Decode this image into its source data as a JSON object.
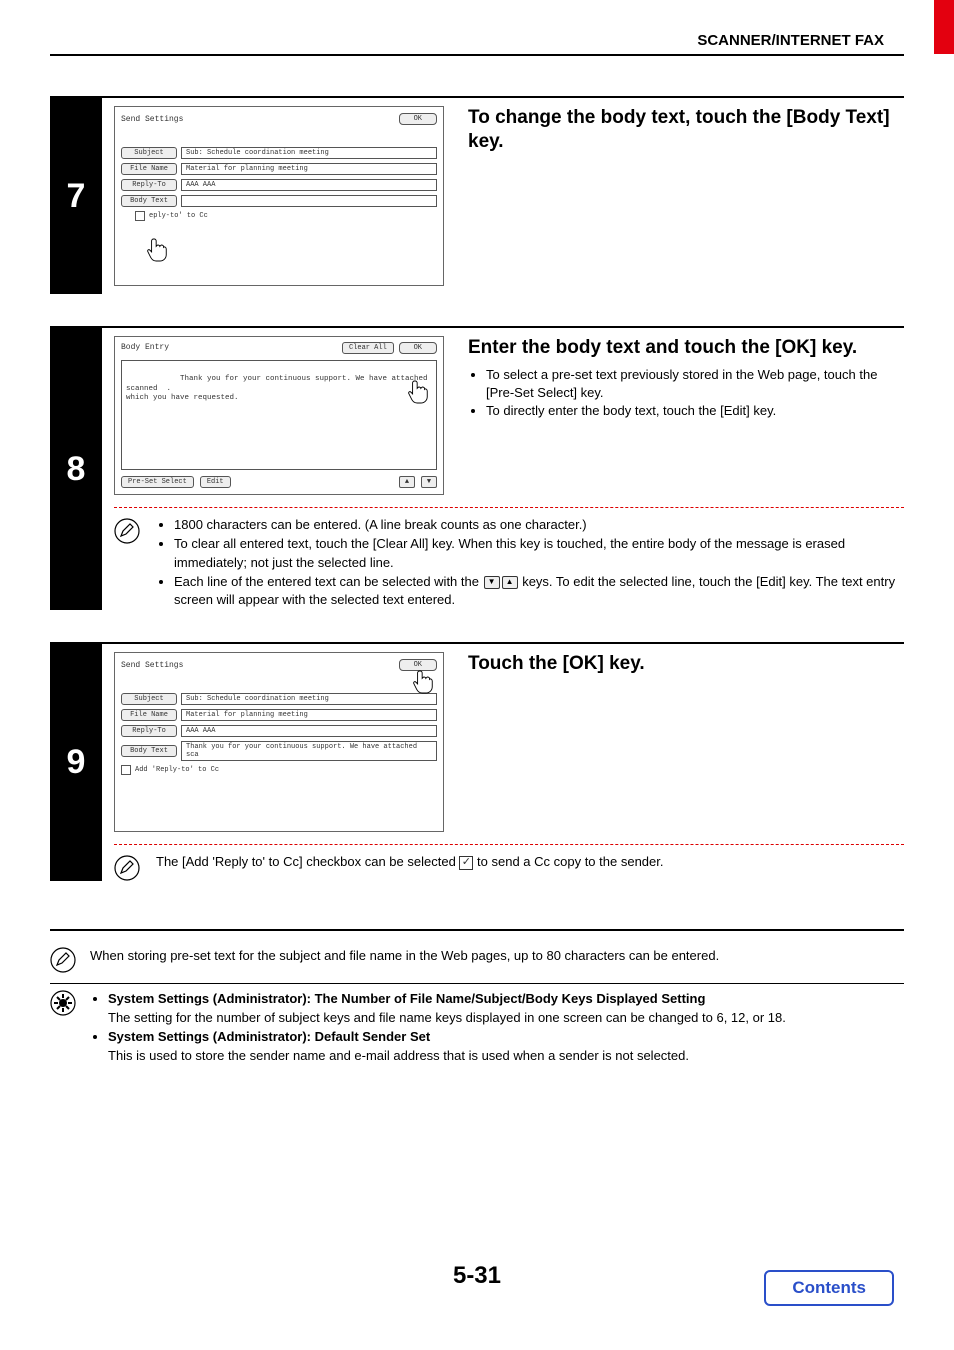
{
  "header": {
    "title": "SCANNER/INTERNET FAX"
  },
  "steps": [
    {
      "num": "7",
      "mock": {
        "title": "Send Settings",
        "ok": "OK",
        "rows": [
          {
            "label": "Subject",
            "value": "Sub: Schedule coordination meeting"
          },
          {
            "label": "File Name",
            "value": "Material for planning meeting"
          },
          {
            "label": "Reply-To",
            "value": "AAA AAA"
          },
          {
            "label": "Body Text",
            "value": ""
          }
        ],
        "checkbox_label": "eply-to' to Cc"
      },
      "instr_title": "To change the body text, touch the [Body Text] key."
    },
    {
      "num": "8",
      "mock": {
        "title": "Body Entry",
        "clear_all": "Clear All",
        "ok": "OK",
        "body_text": "Thank you for your continuous support. We have attached scanned  .\nwhich you have requested.",
        "preset": "Pre-Set Select",
        "edit": "Edit"
      },
      "instr_title": "Enter the body text and touch the [OK] key.",
      "instr_bullets": [
        "To select a pre-set text previously stored in the Web page, touch the [Pre-Set Select] key.",
        "To directly enter the body text, touch the [Edit] key."
      ],
      "note_bullets": [
        "1800 characters can be entered. (A line break counts as one character.)",
        "To clear all entered text, touch the [Clear All] key. When this key is touched, the entire body of the message is erased immediately; not just the selected line.",
        "Each line of the entered text can be selected with the {arrows} keys. To edit the selected line, touch the [Edit] key. The text entry screen will appear with the selected text entered."
      ]
    },
    {
      "num": "9",
      "mock": {
        "title": "Send Settings",
        "ok": "OK",
        "rows": [
          {
            "label": "Subject",
            "value": "Sub: Schedule coordination meeting"
          },
          {
            "label": "File Name",
            "value": "Material for planning meeting"
          },
          {
            "label": "Reply-To",
            "value": "AAA AAA"
          },
          {
            "label": "Body Text",
            "value": "Thank you for your continuous support. We have attached sca"
          }
        ],
        "checkbox_label": "Add 'Reply-to' to Cc"
      },
      "instr_title": "Touch the [OK] key.",
      "note_text_pre": "The [Add 'Reply to' to Cc] checkbox can be selected ",
      "note_text_post": " to send a Cc copy to the sender."
    }
  ],
  "footer_notes": {
    "pencil": "When storing pre-set text for the subject and file name in the Web pages, up to 80 characters can be entered.",
    "gear": [
      {
        "bold": "System Settings (Administrator): The Number of File Name/Subject/Body Keys Displayed Setting",
        "text": "The setting for the number of subject keys and file name keys displayed in one screen can be changed to 6, 12, or 18."
      },
      {
        "bold": "System Settings (Administrator): Default Sender Set",
        "text": "This is used to store the sender name and e-mail address that is used when a sender is not selected."
      }
    ]
  },
  "page_num": "5-31",
  "contents": "Contents"
}
